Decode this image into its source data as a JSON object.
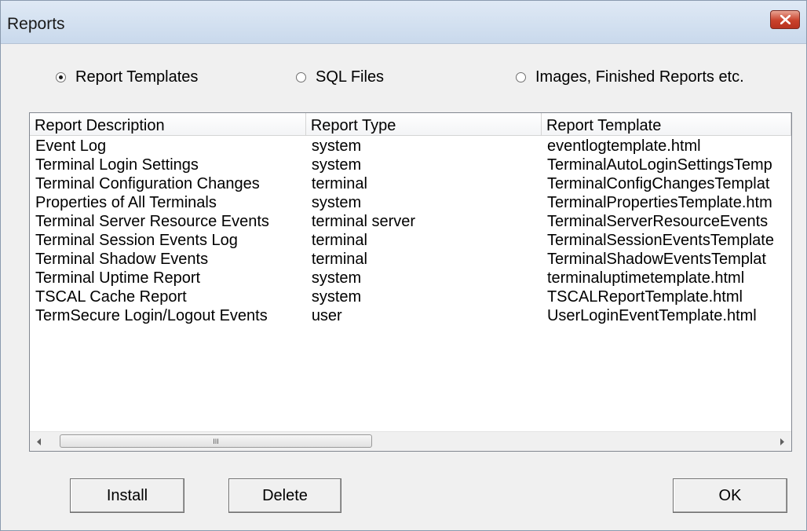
{
  "window": {
    "title": "Reports"
  },
  "radio_options": [
    {
      "label": "Report Templates",
      "checked": true
    },
    {
      "label": "SQL Files",
      "checked": false
    },
    {
      "label": "Images, Finished Reports etc.",
      "checked": false
    }
  ],
  "table": {
    "columns": [
      "Report Description",
      "Report Type",
      "Report Template"
    ],
    "rows": [
      [
        "Event Log",
        "system",
        "eventlogtemplate.html"
      ],
      [
        "Terminal Login Settings",
        "system",
        "TerminalAutoLoginSettingsTemp"
      ],
      [
        "Terminal Configuration Changes",
        "terminal",
        "TerminalConfigChangesTemplat"
      ],
      [
        "Properties of All Terminals",
        "system",
        "TerminalPropertiesTemplate.htm"
      ],
      [
        "Terminal Server Resource Events",
        "terminal server",
        "TerminalServerResourceEvents"
      ],
      [
        "Terminal Session Events Log",
        "terminal",
        "TerminalSessionEventsTemplate"
      ],
      [
        "Terminal Shadow Events",
        "terminal",
        "TerminalShadowEventsTemplat"
      ],
      [
        "Terminal Uptime Report",
        "system",
        "terminaluptimetemplate.html"
      ],
      [
        "TSCAL Cache Report",
        "system",
        "TSCALReportTemplate.html"
      ],
      [
        "TermSecure Login/Logout Events",
        "user",
        "UserLoginEventTemplate.html"
      ]
    ]
  },
  "scrollbar": {
    "grip": "III"
  },
  "buttons": {
    "install": "Install",
    "delete": "Delete",
    "ok": "OK"
  }
}
